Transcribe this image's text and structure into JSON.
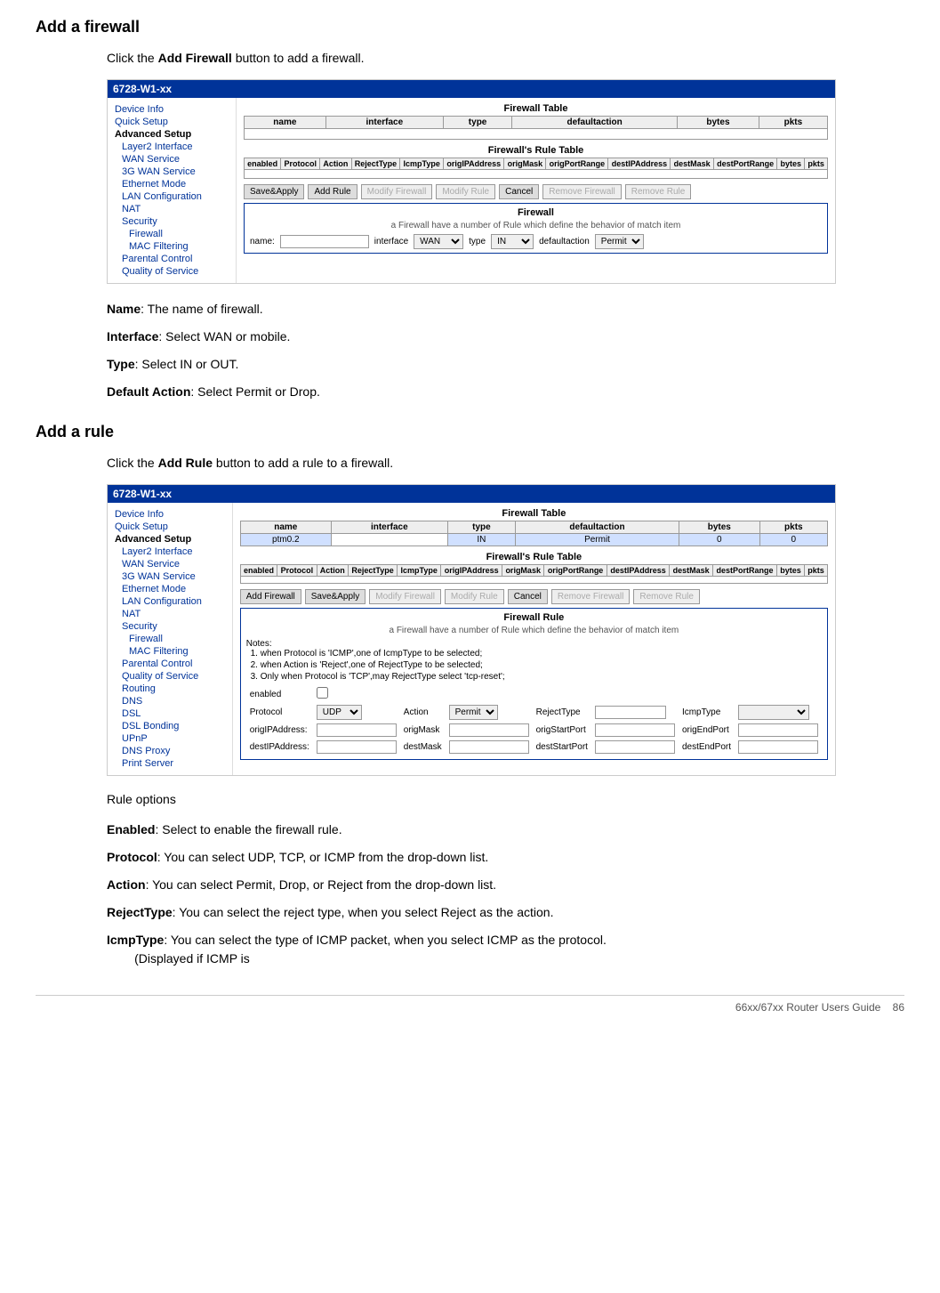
{
  "sections": [
    {
      "id": "add-firewall",
      "title": "Add a firewall",
      "intro": "Click the ",
      "intro_bold": "Add Firewall",
      "intro_after": " button to add a firewall.",
      "screenshot": {
        "header": "6728-W1-xx",
        "nav_items": [
          {
            "label": "Device Info",
            "indent": 0
          },
          {
            "label": "Quick Setup",
            "indent": 0
          },
          {
            "label": "Advanced Setup",
            "indent": 0,
            "bold": true
          },
          {
            "label": "Layer2 Interface",
            "indent": 1
          },
          {
            "label": "WAN Service",
            "indent": 1
          },
          {
            "label": "3G WAN Service",
            "indent": 1
          },
          {
            "label": "Ethernet Mode",
            "indent": 1
          },
          {
            "label": "LAN Configuration",
            "indent": 1
          },
          {
            "label": "NAT",
            "indent": 1
          },
          {
            "label": "Security",
            "indent": 1
          },
          {
            "label": "Firewall",
            "indent": 2
          },
          {
            "label": "MAC Filtering",
            "indent": 2
          },
          {
            "label": "Parental Control",
            "indent": 1
          },
          {
            "label": "Quality of Service",
            "indent": 1
          }
        ],
        "fw_table_title": "Firewall Table",
        "fw_table_headers": [
          "name",
          "interface",
          "type",
          "defaultaction",
          "bytes",
          "pkts"
        ],
        "rule_table_title": "Firewall's Rule Table",
        "rule_table_headers": [
          "enabled",
          "Protocol",
          "Action",
          "RejectType",
          "IcmpType",
          "origIPAddress",
          "origMask",
          "origPortRange",
          "destIPAddress",
          "destMask",
          "destPortRange",
          "bytes",
          "pkts"
        ],
        "buttons1": [
          "Save&Apply",
          "Add Rule",
          "Modify Firewall",
          "Modify Rule",
          "Cancel",
          "Remove Firewall",
          "Remove Rule"
        ],
        "firewall_section_label": "Firewall",
        "firewall_desc": "a Firewall have a number of Rule which define the behavior of match item",
        "name_label": "name:",
        "interface_label": "interface",
        "interface_value": "WAN",
        "type_label": "type",
        "type_value": "IN",
        "defaultaction_label": "defaultaction",
        "defaultaction_value": "Permit"
      },
      "props": [
        {
          "bold": "Name",
          "text": ": The name of firewall."
        },
        {
          "bold": "Interface",
          "text": ": Select WAN or mobile."
        },
        {
          "bold": "Type",
          "text": ": Select IN or OUT."
        },
        {
          "bold": "Default Action",
          "text": ": Select Permit or Drop."
        }
      ]
    },
    {
      "id": "add-rule",
      "title": "Add a rule",
      "intro": "Click the ",
      "intro_bold": "Add Rule",
      "intro_after": " button to add a rule to a firewall.",
      "screenshot": {
        "header": "6728-W1-xx",
        "nav_items": [
          {
            "label": "Device Info",
            "indent": 0
          },
          {
            "label": "Quick Setup",
            "indent": 0
          },
          {
            "label": "Advanced Setup",
            "indent": 0,
            "bold": true
          },
          {
            "label": "Layer2 Interface",
            "indent": 1
          },
          {
            "label": "WAN Service",
            "indent": 1
          },
          {
            "label": "3G WAN Service",
            "indent": 1
          },
          {
            "label": "Ethernet Mode",
            "indent": 1
          },
          {
            "label": "LAN Configuration",
            "indent": 1
          },
          {
            "label": "NAT",
            "indent": 1
          },
          {
            "label": "Security",
            "indent": 1
          },
          {
            "label": "Firewall",
            "indent": 2
          },
          {
            "label": "MAC Filtering",
            "indent": 2
          },
          {
            "label": "Parental Control",
            "indent": 1
          },
          {
            "label": "Quality of Service",
            "indent": 1
          },
          {
            "label": "Routing",
            "indent": 1
          },
          {
            "label": "DNS",
            "indent": 1
          },
          {
            "label": "DSL",
            "indent": 1
          },
          {
            "label": "DSL Bonding",
            "indent": 1
          },
          {
            "label": "UPnP",
            "indent": 1
          },
          {
            "label": "DNS Proxy",
            "indent": 1
          },
          {
            "label": "Print Server",
            "indent": 1
          }
        ],
        "fw_table_title": "Firewall Table",
        "fw_table_headers": [
          "name",
          "interface",
          "type",
          "defaultaction",
          "bytes",
          "pkts"
        ],
        "fw_table_row": [
          "ptm0.2",
          "IN",
          "Permit",
          "0",
          "0"
        ],
        "rule_table_title": "Firewall's Rule Table",
        "rule_table_headers": [
          "enabled",
          "Protocol",
          "Action",
          "RejectType",
          "IcmpType",
          "origIPAddress",
          "origMask",
          "origPortRange",
          "destIPAddress",
          "destMask",
          "destPortRange",
          "bytes",
          "pkts"
        ],
        "buttons2": [
          "Add Firewall",
          "Save&Apply",
          "Modify Firewall",
          "Modify Rule",
          "Cancel",
          "Remove Firewall",
          "Remove Rule"
        ],
        "firewall_rule_label": "Firewall Rule",
        "firewall_desc": "a Firewall have a number of Rule which define the behavior of match item",
        "notes_label": "Notes:",
        "notes": [
          "when Protocol is 'ICMP',one of IcmpType to be selected;",
          "when Action is 'Reject',one of RejectType to be selected;",
          "Only when Protocol is 'TCP',may RejectType select 'tcp-reset';"
        ],
        "rule_form": {
          "enabled_label": "enabled",
          "protocol_label": "Protocol",
          "action_label": "Action",
          "action_value": "Permit",
          "rejecttype_label": "RejectType",
          "icmptype_label": "IcmpType",
          "origip_label": "origIPAddress:",
          "origmask_label": "origMask",
          "origstart_label": "origStartPort",
          "origend_label": "origEndPort",
          "destip_label": "destIPAddress:",
          "destmask_label": "destMask",
          "deststart_label": "destStartPort",
          "destend_label": "destEndPort"
        }
      },
      "rule_options_label": "Rule options",
      "props": [
        {
          "bold": "Enabled",
          "text": ": Select to enable the firewall rule."
        },
        {
          "bold": "Protocol",
          "text": ": You can select UDP, TCP, or ICMP from the drop-down list."
        },
        {
          "bold": "Action",
          "text": ": You can select Permit, Drop, or Reject from the drop-down list."
        },
        {
          "bold": "RejectType",
          "text": ": You can select the reject type, when you select Reject as the action."
        },
        {
          "bold": "IcmpType",
          "text": ": You can select the type of ICMP packet, when you select ICMP as the protocol.\n        (Displayed if ICMP is"
        }
      ]
    }
  ],
  "footer": {
    "text": "66xx/67xx Router Users Guide",
    "page": "86"
  }
}
